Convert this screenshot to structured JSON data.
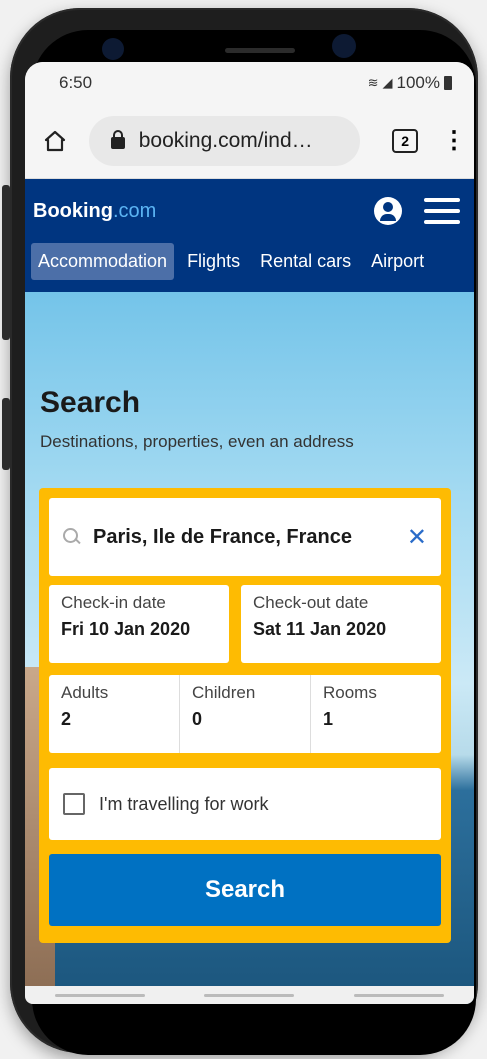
{
  "status_bar": {
    "time": "6:50",
    "signal_battery": "100%"
  },
  "browser": {
    "url": "booking.com/ind…",
    "tabs_count": "2"
  },
  "site": {
    "logo_main": "Booking",
    "logo_suffix": ".com"
  },
  "nav_tabs": [
    {
      "label": "Accommodation",
      "active": true
    },
    {
      "label": "Flights"
    },
    {
      "label": "Rental cars"
    },
    {
      "label": "Airport"
    }
  ],
  "search": {
    "title": "Search",
    "subtitle": "Destinations, properties, even an address",
    "destination": "Paris, Ile de France, France",
    "checkin_label": "Check-in date",
    "checkin_value": "Fri 10 Jan 2020",
    "checkout_label": "Check-out date",
    "checkout_value": "Sat 11 Jan 2020",
    "adults_label": "Adults",
    "adults_value": "2",
    "children_label": "Children",
    "children_value": "0",
    "rooms_label": "Rooms",
    "rooms_value": "1",
    "work_label": "I'm travelling for work",
    "button_label": "Search"
  },
  "colors": {
    "brand_blue": "#003580",
    "search_yellow": "#febb02",
    "button_blue": "#0071c2"
  }
}
